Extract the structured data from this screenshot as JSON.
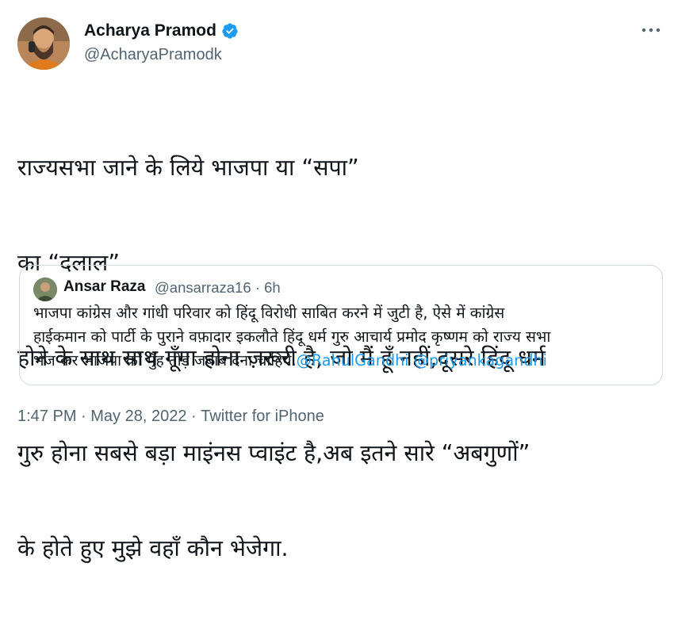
{
  "author": {
    "name": "Acharya Pramod",
    "handle": "@AcharyaPramodk",
    "avatar_icon": "person-avatar-icon",
    "verified_icon": "verified-badge-icon",
    "verified_color": "#1d9bf0"
  },
  "menu": {
    "more_icon": "more-options-icon"
  },
  "tweet": {
    "text_lines": [
      "राज्यसभा जाने के लिये भाजपा या “सपा”",
      "का “दलाल”",
      "होने के साथ साथ गूँगा होना ज़रूरी है, जो मैं हूँ नहीं,दूसरे हिंदू धर्म",
      "गुरु होना सबसे बड़ा माइंनस प्वाइंट है,अब इतने सारे “अबगुणों”",
      "के होते हुए मुझे वहाँ कौन भेजेगा."
    ]
  },
  "quoted_tweet": {
    "name": "Ansar Raza",
    "handle": "@ansarraza16",
    "separator": " · ",
    "time": "6h",
    "text_lines": [
      "भाजपा कांग्रेस और गांधी परिवार को हिंदू विरोधी साबित करने में जुटी है, ऐसे में कांग्रेस",
      "हाईकमान को पार्टी के पुराने वफ़ादार इकलौते हिंदू धर्म गुरु आचार्य प्रमोद कृष्णम को राज्य सभा",
      "भेज कर भाजपा को मुँह तोड़ जबाब देना चाहिये."
    ],
    "mentions": [
      "@RahulGandhi",
      "@priyankagandhi"
    ]
  },
  "footer": {
    "time": "1:47 PM",
    "separator": " · ",
    "date": "May 28, 2022",
    "source": "Twitter for iPhone"
  }
}
